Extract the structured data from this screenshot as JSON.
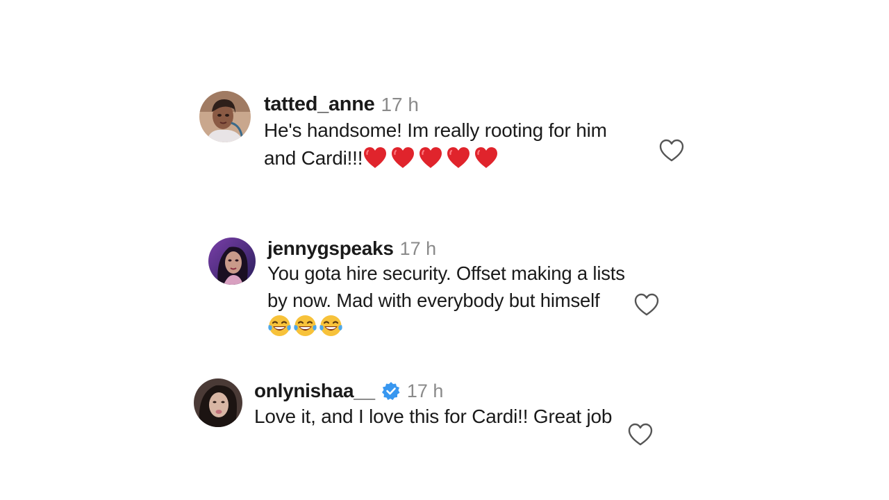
{
  "comments": [
    {
      "username": "tatted_anne",
      "time": "17 h",
      "text": "He's handsome! Im really rooting for him and Cardi!!!",
      "emoji": [
        "❤️",
        "❤️",
        "❤️",
        "❤️",
        "❤️"
      ],
      "avatar_icon": "avatar-photo-icon",
      "like_icon": "heart-outline-icon"
    },
    {
      "username": "jennygspeaks",
      "time": "17 h",
      "text": "You gota hire security. Offset making a lists by now. Mad with everybody but himself",
      "emoji": [
        "😂",
        "😂",
        "😂"
      ],
      "avatar_icon": "avatar-photo-icon",
      "like_icon": "heart-outline-icon"
    },
    {
      "username": "onlynishaa__",
      "time": "17 h",
      "verified": true,
      "text": "Love it, and I love this for Cardi!! Great job",
      "avatar_icon": "avatar-photo-icon",
      "like_icon": "heart-outline-icon"
    }
  ],
  "colors": {
    "text": "#1a1a1a",
    "muted": "#8a8a8a",
    "verified_blue": "#3897f0",
    "heart_red": "#e0242c"
  }
}
